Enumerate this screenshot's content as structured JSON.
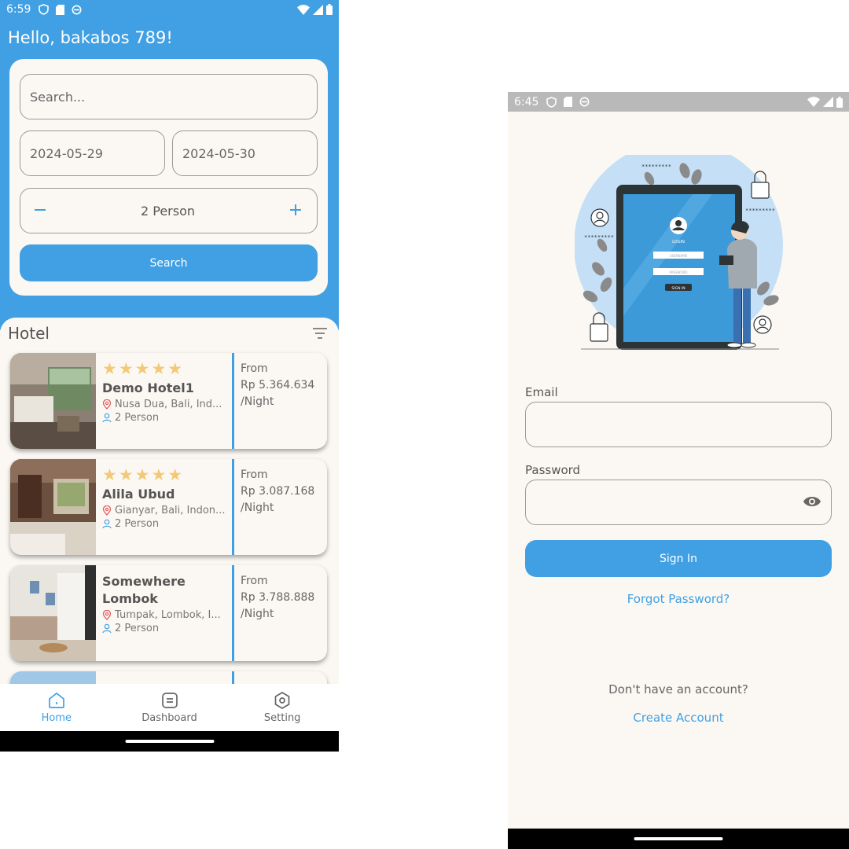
{
  "left_screen": {
    "status": {
      "time": "6:59"
    },
    "greeting": "Hello, bakabos 789!",
    "search": {
      "placeholder": "Search...",
      "check_in": "2024-05-29",
      "check_out": "2024-05-30",
      "guests": "2 Person",
      "button_label": "Search"
    },
    "list_title": "Hotel",
    "hotels": [
      {
        "stars": 5,
        "name": "Demo Hotel1",
        "location": "Nusa Dua, Bali, Ind...",
        "guests": "2 Person",
        "from": "From",
        "price": "Rp 5.364.634",
        "unit": "/Night"
      },
      {
        "stars": 5,
        "name": "Alila Ubud",
        "location": "Gianyar, Bali, Indon...",
        "guests": "2 Person",
        "from": "From",
        "price": "Rp 3.087.168",
        "unit": "/Night"
      },
      {
        "stars": 0,
        "name": "Somewhere Lombok",
        "location": "Tumpak, Lombok, I...",
        "guests": "2 Person",
        "from": "From",
        "price": "Rp 3.788.888",
        "unit": "/Night"
      }
    ],
    "nav": {
      "home": "Home",
      "dashboard": "Dashboard",
      "setting": "Setting"
    },
    "colors": {
      "primary": "#40a0e3",
      "star": "#f3c978",
      "background": "#fbf8f3"
    }
  },
  "right_screen": {
    "status": {
      "time": "6:45"
    },
    "illustration": {
      "login_label": "LOGIN",
      "username_placeholder": "USERNAME",
      "password_placeholder": "PASSWORD",
      "sign_in": "SIGN IN",
      "masked": "*********"
    },
    "email_label": "Email",
    "password_label": "Password",
    "sign_in_label": "Sign In",
    "forgot_label": "Forgot Password?",
    "no_account": "Don't have an account?",
    "create_account": "Create Account"
  }
}
